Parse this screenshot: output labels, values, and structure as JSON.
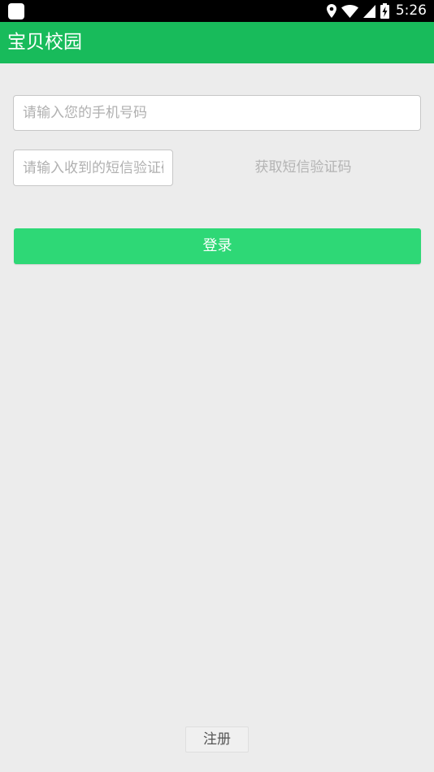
{
  "status_bar": {
    "time": "5:26",
    "icons": [
      "notification-square-icon",
      "location-pin-icon",
      "wifi-icon",
      "cellular-signal-icon",
      "battery-charging-icon"
    ]
  },
  "app_bar": {
    "title": "宝贝校园"
  },
  "login_form": {
    "phone_placeholder": "请输入您的手机号码",
    "code_placeholder": "请输入收到的短信验证码",
    "get_code_label": "获取短信验证码",
    "login_label": "登录"
  },
  "footer": {
    "register_label": "注册"
  },
  "colors": {
    "app_bar": "#18bb5b",
    "login_button": "#2ed876",
    "background": "#ececec"
  }
}
